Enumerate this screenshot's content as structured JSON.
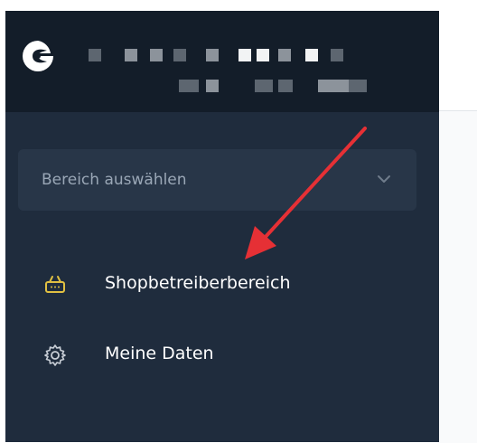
{
  "area_select": {
    "label": "Bereich auswählen"
  },
  "nav": {
    "shop_owner_area": {
      "label": "Shopbetreiberbereich"
    },
    "my_data": {
      "label": "Meine Daten"
    }
  },
  "colors": {
    "sidebar_bg": "#1f2c3d",
    "header_bg": "#131d29",
    "basket_icon": "#e0c042",
    "annotation_arrow": "#e63035"
  }
}
